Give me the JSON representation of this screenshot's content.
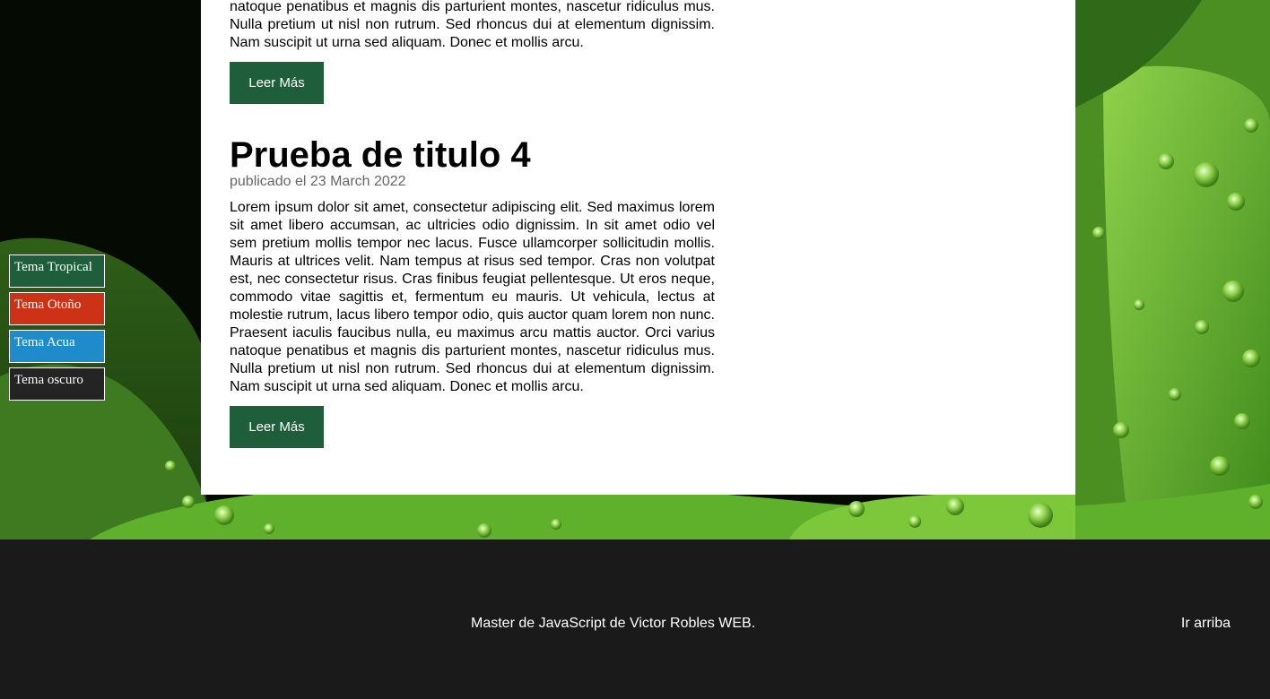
{
  "themes": [
    {
      "label": "Tema Tropical",
      "color": "#1f5e3a"
    },
    {
      "label": "Tema Otoño",
      "color": "#cc3316"
    },
    {
      "label": "Tema Acua",
      "color": "#1e8ccb"
    },
    {
      "label": "Tema oscuro",
      "color": "#242424"
    }
  ],
  "posts": [
    {
      "body_partial": "natoque penatibus et magnis dis parturient montes, nascetur ridiculus mus. Nulla pretium ut nisl non rutrum. Sed rhoncus dui at elementum dignissim. Nam suscipit ut urna sed aliquam. Donec et mollis arcu.",
      "read_more": "Leer Más"
    },
    {
      "title": "Prueba de titulo 4",
      "date": "publicado el 23 March 2022",
      "body": "Lorem ipsum dolor sit amet, consectetur adipiscing elit. Sed maximus lorem sit amet libero accumsan, ac ultricies odio dignissim. In sit amet odio vel sem pretium mollis tempor nec lacus. Fusce ullamcorper sollicitudin mollis. Mauris at ultrices velit. Nam tempus at risus sed tempor. Cras non volutpat est, nec consectetur risus. Cras finibus feugiat pellentesque. Ut eros neque, commodo vitae sagittis et, fermentum eu mauris. Ut vehicula, lectus at molestie rutrum, lacus libero tempor odio, quis auctor quam lorem non nunc. Praesent iaculis faucibus nulla, eu maximus arcu mattis auctor. Orci varius natoque penatibus et magnis dis parturient montes, nascetur ridiculus mus. Nulla pretium ut nisl non rutrum. Sed rhoncus dui at elementum dignissim. Nam suscipit ut urna sed aliquam. Donec et mollis arcu.",
      "read_more": "Leer Más"
    }
  ],
  "footer": {
    "text": "Master de JavaScript de Victor Robles WEB.",
    "to_top": "Ir arriba"
  }
}
